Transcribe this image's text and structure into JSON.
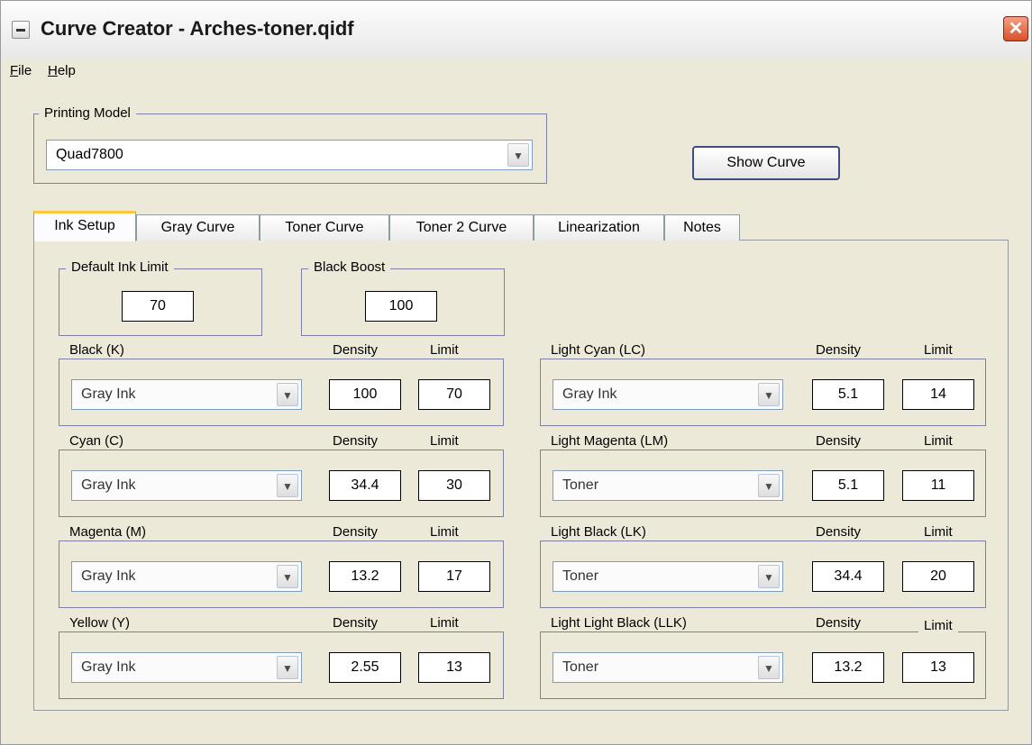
{
  "window": {
    "title": "Curve Creator - Arches-toner.qidf",
    "close_icon": "close-icon",
    "app_icon": "window-menu-icon"
  },
  "menu": {
    "file": "File",
    "help": "Help"
  },
  "printing_model": {
    "label": "Printing Model",
    "value": "Quad7800"
  },
  "show_curve": "Show Curve",
  "tabs": [
    "Ink Setup",
    "Gray Curve",
    "Toner Curve",
    "Toner 2 Curve",
    "Linearization",
    "Notes"
  ],
  "active_tab": "Ink Setup",
  "default_ink_limit": {
    "label": "Default Ink Limit",
    "value": "70"
  },
  "black_boost": {
    "label": "Black Boost",
    "value": "100"
  },
  "col_labels": {
    "density": "Density",
    "limit": "Limit"
  },
  "inks_left": [
    {
      "name": "Black (K)",
      "type": "Gray Ink",
      "density": "100",
      "limit": "70"
    },
    {
      "name": "Cyan (C)",
      "type": "Gray Ink",
      "density": "34.4",
      "limit": "30"
    },
    {
      "name": "Magenta (M)",
      "type": "Gray Ink",
      "density": "13.2",
      "limit": "17"
    },
    {
      "name": "Yellow (Y)",
      "type": "Gray Ink",
      "density": "2.55",
      "limit": "13"
    }
  ],
  "inks_right": [
    {
      "name": "Light Cyan (LC)",
      "type": "Gray Ink",
      "density": "5.1",
      "limit": "14"
    },
    {
      "name": "Light Magenta (LM)",
      "type": "Toner",
      "density": "5.1",
      "limit": "11"
    },
    {
      "name": "Light Black (LK)",
      "type": "Toner",
      "density": "34.4",
      "limit": "20"
    },
    {
      "name": "Light Light Black (LLK)",
      "type": "Toner",
      "density": "13.2",
      "limit": "13"
    }
  ]
}
